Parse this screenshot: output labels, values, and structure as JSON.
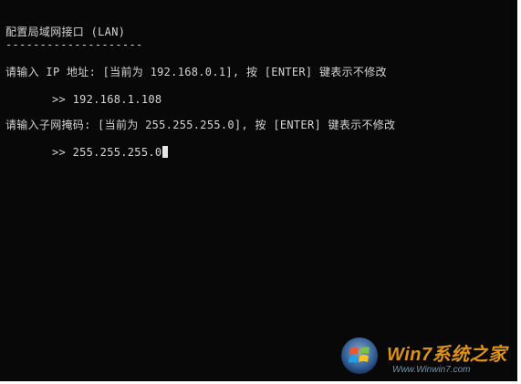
{
  "console": {
    "heading": "配置局域网接口 (LAN)",
    "separator": "--------------------",
    "ip_prompt": "请输入 IP 地址: [当前为 192.168.0.1], 按 [ENTER] 键表示不修改",
    "ip_input": ">> 192.168.1.108",
    "mask_prompt": "请输入子网掩码: [当前为 255.255.255.0], 按 [ENTER] 键表示不修改",
    "mask_input": ">> 255.255.255.0"
  },
  "watermark": {
    "title": "Win7系统之家",
    "url": "Www.Winwin7.com",
    "icon": "windows-logo-icon"
  },
  "colors": {
    "background": "#080808",
    "text": "#d4d4d4",
    "watermark_orange": "#f4a21c"
  }
}
